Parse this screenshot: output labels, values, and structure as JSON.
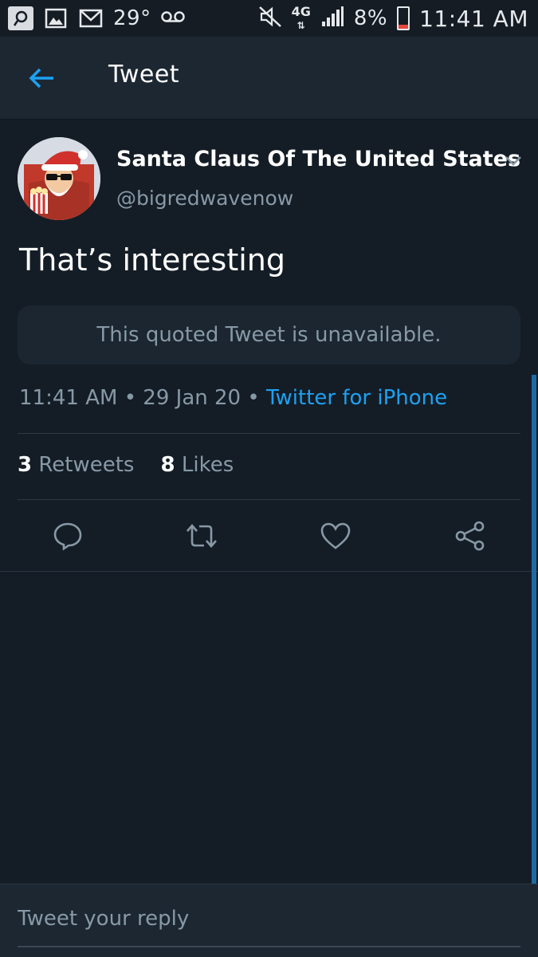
{
  "status_bar": {
    "temperature": "29°",
    "network": "4G",
    "battery": "8%",
    "battery_level": 0.08,
    "time": "11:41 AM"
  },
  "header": {
    "title": "Tweet",
    "back_icon": "arrow-left-icon"
  },
  "tweet": {
    "author_name": "Santa Claus Of The United States",
    "author_handle": "@bigredwavenow",
    "text": "That’s interesting",
    "quoted_unavailable": "This quoted Tweet is unavailable.",
    "time": "11:41 AM",
    "separator": "•",
    "date": "29 Jan 20",
    "source": "Twitter for iPhone",
    "retweets_count": "3",
    "retweets_label": "Retweets",
    "likes_count": "8",
    "likes_label": "Likes"
  },
  "actions": [
    "reply-icon",
    "retweet-icon",
    "like-icon",
    "share-icon"
  ],
  "reply": {
    "placeholder": "Tweet your reply"
  },
  "colors": {
    "background": "#141d26",
    "header": "#1c2732",
    "accent": "#1da1f2",
    "muted": "#8899a6"
  }
}
